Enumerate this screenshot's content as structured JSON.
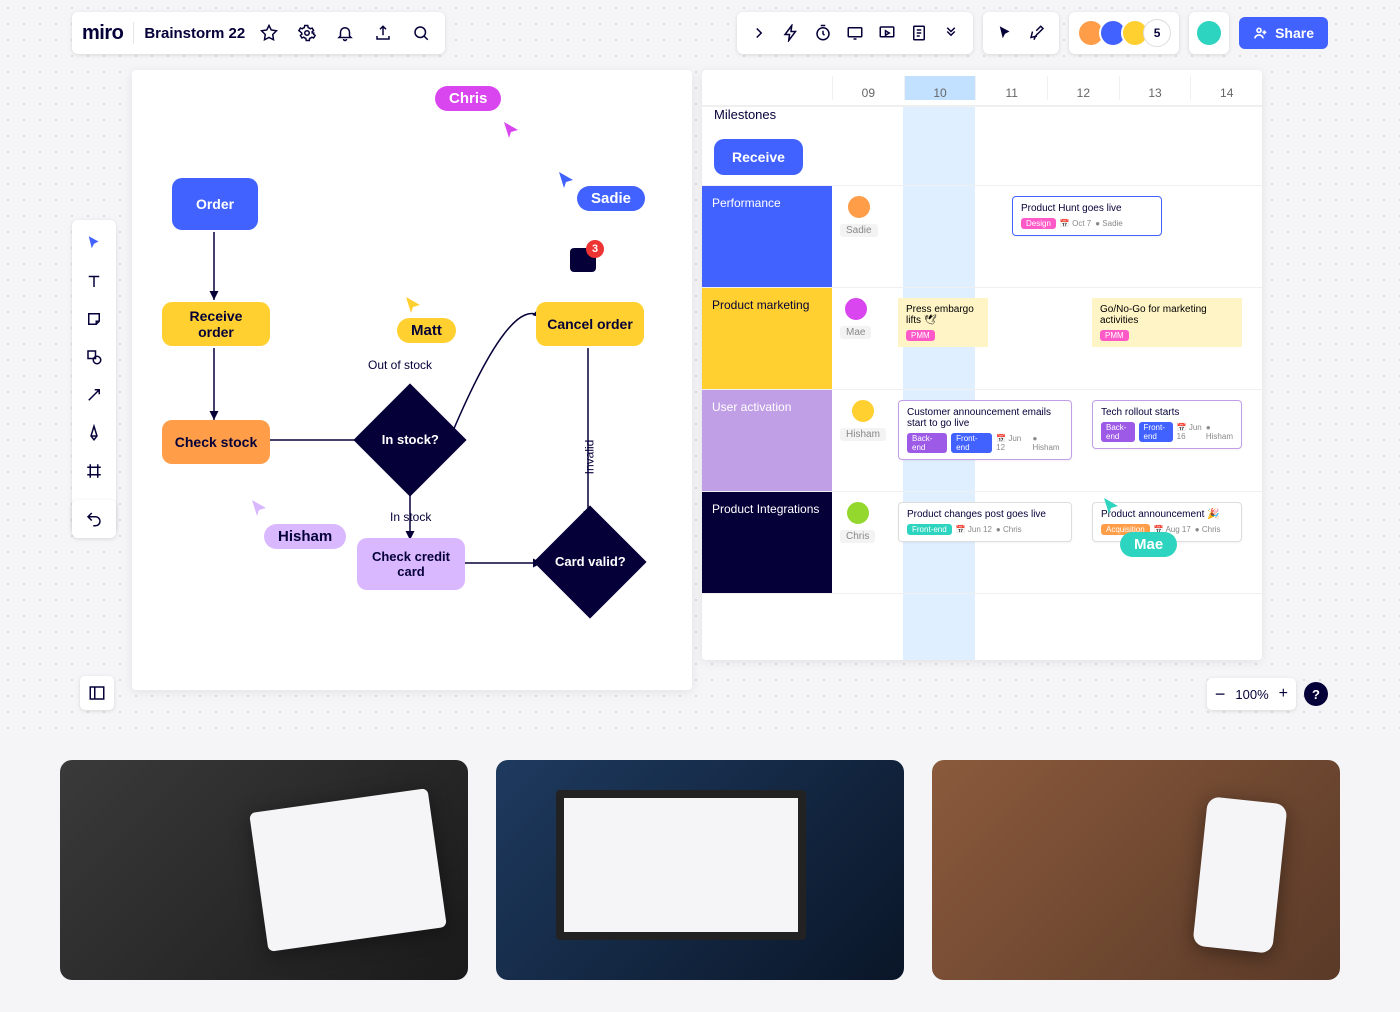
{
  "app": {
    "logo": "miro",
    "board_title": "Brainstorm 22",
    "share_label": "Share"
  },
  "presence": {
    "count": "5"
  },
  "cursors": {
    "chris": "Chris",
    "sadie": "Sadie",
    "matt": "Matt",
    "hisham": "Hisham",
    "mae": "Mae"
  },
  "comment_count": "3",
  "flow": {
    "order": "Order",
    "receive": "Receive order",
    "check_stock": "Check stock",
    "in_stock_q": "In stock?",
    "cancel": "Cancel order",
    "check_cc": "Check credit card",
    "card_valid_q": "Card valid?",
    "lbl_out": "Out of stock",
    "lbl_in": "In stock",
    "lbl_invalid": "Invalid"
  },
  "timeline": {
    "milestones_label": "Milestones",
    "receive_pill": "Receive",
    "days": [
      "09",
      "10",
      "11",
      "12",
      "13",
      "14"
    ],
    "rows": {
      "perf": {
        "label": "Performance",
        "person": "Sadie",
        "card1": {
          "title": "Product Hunt goes live",
          "tag": "Design",
          "date": "Oct 7",
          "owner": "Sadie"
        }
      },
      "pm": {
        "label": "Product marketing",
        "person": "Mae",
        "note1": {
          "text": "Press embargo lifts 🕊",
          "tag": "PMM"
        },
        "note2": {
          "text": "Go/No-Go for marketing activities",
          "tag": "PMM"
        }
      },
      "ua": {
        "label": "User activation",
        "person": "Hisham",
        "card1": {
          "title": "Customer announcement emails start to go live",
          "tag1": "Back-end",
          "tag2": "Front-end",
          "date": "Jun 12",
          "owner": "Hisham"
        },
        "card2": {
          "title": "Tech rollout starts",
          "tag1": "Back-end",
          "tag2": "Front-end",
          "date": "Jun 16",
          "owner": "Hisham"
        }
      },
      "pi": {
        "label": "Product Integrations",
        "person": "Chris",
        "card1": {
          "title": "Product changes post goes live",
          "tag1": "Front-end",
          "date": "Jun 12",
          "owner": "Chris"
        },
        "card2": {
          "title": "Product announcement 🎉",
          "tag1": "Acquisition",
          "date": "Aug 17",
          "owner": "Chris"
        }
      }
    }
  },
  "zoom": {
    "level": "100%"
  }
}
